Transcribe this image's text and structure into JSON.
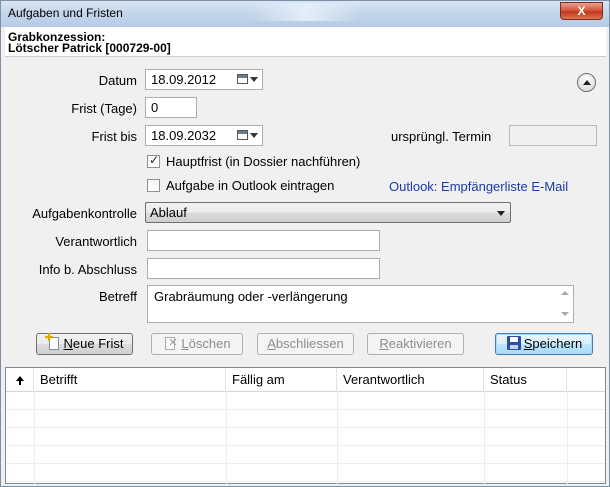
{
  "window": {
    "title": "Aufgaben und Fristen",
    "close_label": "X"
  },
  "header": {
    "line1": "Grabkonzession:",
    "line2": "Lötscher Patrick [000729-00]"
  },
  "form": {
    "datum_label": "Datum",
    "datum_value": "18.09.2012",
    "frist_tage_label": "Frist (Tage)",
    "frist_tage_value": "0",
    "frist_bis_label": "Frist bis",
    "frist_bis_value": "18.09.2032",
    "urspr_termin_label": "ursprüngl. Termin",
    "urspr_termin_value": "",
    "hauptfrist_label": "Hauptfrist (in Dossier nachführen)",
    "hauptfrist_checked": true,
    "outlook_label": "Aufgabe in Outlook eintragen",
    "outlook_checked": false,
    "outlook_link": "Outlook: Empfängerliste E-Mail",
    "aufgabenkontrolle_label": "Aufgabenkontrolle",
    "aufgabenkontrolle_value": "Ablauf",
    "verantwortlich_label": "Verantwortlich",
    "verantwortlich_value": "",
    "info_label": "Info b. Abschluss",
    "info_value": "",
    "betreff_label": "Betreff",
    "betreff_value": "Grabräumung oder -verlängerung"
  },
  "buttons": {
    "neue_frist_u": "N",
    "neue_frist_rest": "eue Frist",
    "loeschen_u": "L",
    "loeschen_rest": "öschen",
    "abschliessen_u": "A",
    "abschliessen_rest": "bschliessen",
    "reaktivieren_u": "R",
    "reaktivieren_rest": "eaktivieren",
    "speichern_u": "S",
    "speichern_rest": "peichern"
  },
  "table": {
    "columns": [
      "Betrifft",
      "Fällig am",
      "Verantwortlich",
      "Status"
    ],
    "rows": []
  },
  "icons": {
    "calendar": "calendar-dropdown-icon",
    "collapse": "collapse-up-icon",
    "new": "new-document-icon",
    "delete": "delete-document-icon",
    "save": "floppy-disk-icon",
    "sort": "sort-ascending-icon"
  }
}
